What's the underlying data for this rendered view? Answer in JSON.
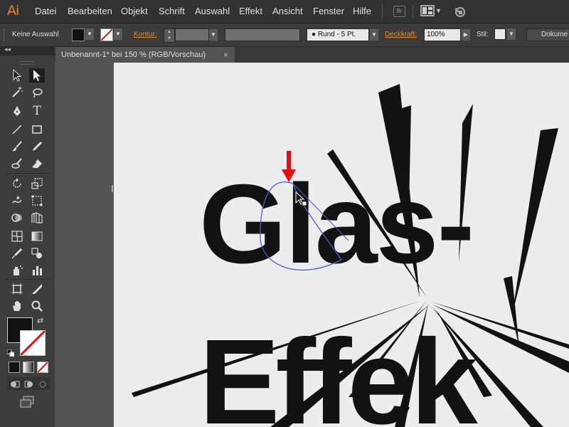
{
  "app": {
    "logo": "Ai",
    "menu": [
      "Datei",
      "Bearbeiten",
      "Objekt",
      "Schrift",
      "Auswahl",
      "Effekt",
      "Ansicht",
      "Fenster",
      "Hilfe"
    ],
    "bridge_label": "Br"
  },
  "control_bar": {
    "selection_status": "Keine Auswahl",
    "stroke_label": "Kontur:",
    "brush_preset": "Rund - 5 Pt.",
    "opacity_label": "Deckkraft:",
    "opacity_value": "100%",
    "style_label": "Stil:",
    "document_button": "Dokume"
  },
  "document": {
    "tab_title": "Unbenannt-1* bei 150 % (RGB/Vorschau)",
    "close_glyph": "×"
  },
  "canvas": {
    "line1_text": "Glas-",
    "line2_text": "Effek"
  },
  "icons": [
    "selection-arrow-icon",
    "direct-selection-icon",
    "magic-wand-icon",
    "lasso-icon",
    "pen-icon",
    "type-icon",
    "line-icon",
    "rectangle-icon",
    "paintbrush-icon",
    "pencil-icon",
    "blob-brush-icon",
    "eraser-icon",
    "rotate-icon",
    "scale-icon",
    "warp-icon",
    "free-transform-icon",
    "shape-builder-icon",
    "perspective-grid-icon",
    "mesh-icon",
    "gradient-icon",
    "eyedropper-icon",
    "blend-icon",
    "symbol-sprayer-icon",
    "column-graph-icon",
    "artboard-icon",
    "slice-icon",
    "hand-icon",
    "zoom-icon"
  ],
  "colors": {
    "accent": "#e6862a",
    "arrow": "#e01010",
    "selection_path": "#4a5fc1"
  }
}
